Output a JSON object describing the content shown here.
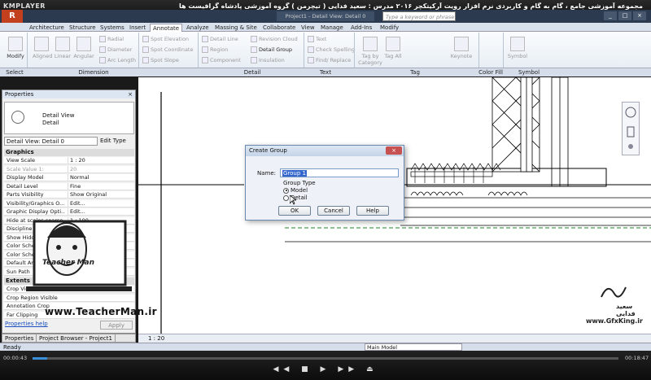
{
  "player": {
    "logo": "KMPLAYER",
    "title": "مجموعه آموزشی جامع ، گام به گام و کاربردی نرم افزار رویت آرکیتکچر ۲۰۱۶ مدرس : سعید فدایی ( تیچرمن ) گروه آموزشی پادشاه گرافیست ها",
    "time_current": "00:00:43",
    "time_total": "00:18:47",
    "controls": "◀◀ ■ ▶ ▶▶ ⏏"
  },
  "revit": {
    "app_menu": "R",
    "doc_title": "Project1 - Detail View: Detail 0",
    "search_placeholder": "Type a keyword or phrase",
    "window_controls": [
      "_",
      "□",
      "×"
    ],
    "tabs": [
      "Architecture",
      "Structure",
      "Systems",
      "Insert",
      "Annotate",
      "Analyze",
      "Massing & Site",
      "Collaborate",
      "View",
      "Manage",
      "Add-Ins",
      "Modify"
    ],
    "active_tab": "Annotate",
    "ribbon": {
      "modify": "Modify",
      "dimension_big": [
        "Aligned",
        "Linear",
        "Angular"
      ],
      "dimension_small": [
        "Radial",
        "Diameter",
        "Arc Length"
      ],
      "spot": [
        "Spot Elevation",
        "Spot Coordinate",
        "Spot Slope"
      ],
      "detail_small": [
        "Detail Line",
        "Region",
        "Component"
      ],
      "detail_small2": [
        "Revision Cloud",
        "Detail Group",
        "Insulation"
      ],
      "text": [
        "Text",
        "Check Spelling",
        "Find/ Replace"
      ],
      "tag": [
        "Tag by Category",
        "Tag All"
      ],
      "keynote": "Keynote",
      "symbol": "Symbol"
    },
    "panels": [
      "Select",
      "Dimension",
      "Detail",
      "Text",
      "Tag",
      "Color Fill",
      "Symbol"
    ],
    "status": "Ready",
    "main_model": "Main Model"
  },
  "properties": {
    "title": "Properties",
    "close": "×",
    "type_name_1": "Detail View",
    "type_name_2": "Detail",
    "view_selector": "Detail View: Detail 0",
    "edit_type": "Edit Type",
    "groups": [
      "Graphics",
      "Extents"
    ],
    "rows": [
      {
        "k": "View Scale",
        "v": "1 : 20"
      },
      {
        "k": "Scale Value    1:",
        "v": "20",
        "dis": true
      },
      {
        "k": "Display Model",
        "v": "Normal"
      },
      {
        "k": "Detail Level",
        "v": "Fine"
      },
      {
        "k": "Parts Visibility",
        "v": "Show Original"
      },
      {
        "k": "Visibility/Graphics O...",
        "v": "Edit..."
      },
      {
        "k": "Graphic Display Opti...",
        "v": "Edit..."
      },
      {
        "k": "Hide at scales coarse...",
        "v": "1 : 100"
      },
      {
        "k": "Discipline",
        "v": ""
      },
      {
        "k": "Show Hidden",
        "v": ""
      },
      {
        "k": "Color Scheme",
        "v": ""
      },
      {
        "k": "Color Scheme",
        "v": ""
      },
      {
        "k": "Default Ana...",
        "v": ""
      },
      {
        "k": "Sun Path",
        "v": ""
      }
    ],
    "extent_rows": [
      {
        "k": "Crop View",
        "v": ""
      },
      {
        "k": "Crop Region Visible",
        "v": ""
      },
      {
        "k": "Annotation Crop",
        "v": ""
      },
      {
        "k": "Far Clipping",
        "v": ""
      }
    ],
    "help": "Properties help",
    "apply": "Apply",
    "bottom_tabs": [
      "Properties",
      "Project Browser - Project1"
    ],
    "scale_label": "1 : 20"
  },
  "dialog": {
    "title": "Create Group",
    "close": "×",
    "name_label": "Name:",
    "name_value": "Group 1",
    "group_type_label": "Group Type",
    "model": "Model",
    "detail": "Detail",
    "ok": "OK",
    "cancel": "Cancel",
    "help": "Help"
  },
  "watermark": {
    "teacherman": "Teacher Man",
    "url": "www.TeacherMan.ir",
    "name_fa": "سعید فدایی",
    "gfx": "www.GfxKing.ir"
  }
}
